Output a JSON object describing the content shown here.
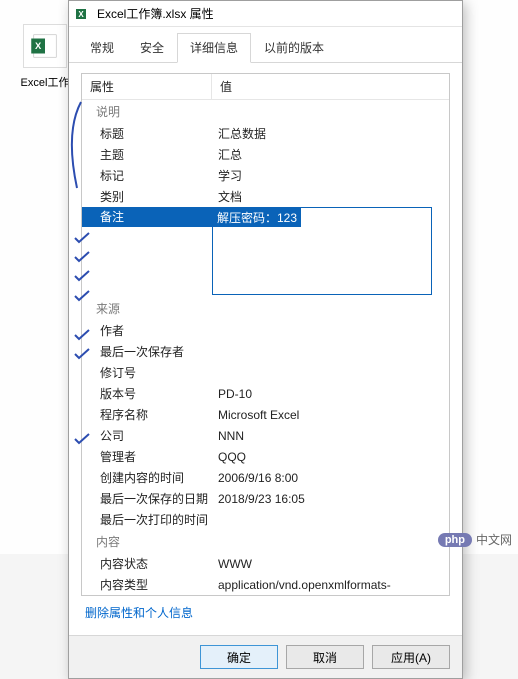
{
  "desktop": {
    "file_label": "Excel工作"
  },
  "dialog": {
    "title": "Excel工作簿.xlsx 属性",
    "tabs": [
      "常规",
      "安全",
      "详细信息",
      "以前的版本"
    ],
    "active_tab_index": 2,
    "header": {
      "key_label": "属性",
      "val_label": "值"
    },
    "sections": [
      {
        "name": "说明",
        "rows": [
          {
            "key": "标题",
            "val": "汇总数据"
          },
          {
            "key": "主题",
            "val": "汇总"
          },
          {
            "key": "标记",
            "val": "学习"
          },
          {
            "key": "类别",
            "val": "文档"
          },
          {
            "key": "备注",
            "val": "解压密码：123",
            "editing": true
          }
        ]
      },
      {
        "name": "来源",
        "rows": [
          {
            "key": "作者",
            "val": ""
          },
          {
            "key": "最后一次保存者",
            "val": ""
          },
          {
            "key": "修订号",
            "val": ""
          },
          {
            "key": "版本号",
            "val": "PD-10"
          },
          {
            "key": "程序名称",
            "val": "Microsoft Excel"
          },
          {
            "key": "公司",
            "val": "NNN"
          },
          {
            "key": "管理者",
            "val": "QQQ"
          },
          {
            "key": "创建内容的时间",
            "val": "2006/9/16 8:00"
          },
          {
            "key": "最后一次保存的日期",
            "val": "2018/9/23 16:05"
          },
          {
            "key": "最后一次打印的时间",
            "val": ""
          }
        ]
      },
      {
        "name": "内容",
        "rows": [
          {
            "key": "内容状态",
            "val": "WWW"
          },
          {
            "key": "内容类型",
            "val": "application/vnd.openxmlformats-"
          }
        ]
      }
    ],
    "remove_link": "删除属性和个人信息",
    "buttons": {
      "ok": "确定",
      "cancel": "取消",
      "apply": "应用(A)"
    }
  },
  "watermark": {
    "badge": "php",
    "text": "中文网"
  }
}
